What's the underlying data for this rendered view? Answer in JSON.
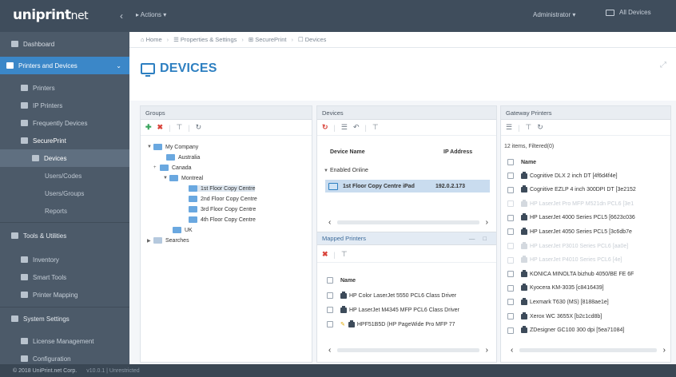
{
  "topbar": {
    "logo": "uniprint",
    "logo_suffix": "net",
    "collapse": "‹",
    "action": "▸ Actions ▾",
    "user": "Administrator ▾",
    "devices": "All Devices"
  },
  "sidebar": {
    "dashboard": "Dashboard",
    "printers_devices": "Printers and Devices",
    "printers": "Printers",
    "ip_printers": "IP Printers",
    "frequently_used": "Frequently Devices",
    "secureprint": "SecurePrint",
    "devices": "Devices",
    "users_codes": "Users/Codes",
    "users_groups": "Users/Groups",
    "reports": "Reports",
    "tools_utilities": "Tools & Utilities",
    "inventory": "Inventory",
    "smart_tools": "Smart Tools",
    "printer_mapping": "Printer Mapping",
    "system_settings": "System Settings",
    "license_management": "License Management",
    "configuration": "Configuration",
    "footer": "© 2018 UniPrint.net Corp.",
    "footer_extra": "v10.0.1 | Unrestricted"
  },
  "breadcrumb": {
    "home": "⌂ Home",
    "properties": "☰ Properties & Settings",
    "secureprint": "⊞ SecurePrint",
    "devices": "☐ Devices"
  },
  "page": {
    "title": "DEVICES",
    "expand": "⤢"
  },
  "groups": {
    "header": "Groups",
    "tb_add": "✚",
    "tb_del": "✖",
    "tb_filter": "⊤",
    "tb_refresh": "↻",
    "tree": {
      "my_company": "My Company",
      "australia": "Australia",
      "canada": "Canada",
      "montreal": "Montreal",
      "floor1": "1st Floor Copy Centre",
      "floor2": "2nd Floor Copy Centre",
      "floor3": "3rd Floor Copy Centre",
      "floor4": "4th Floor Copy Centre",
      "uk": "UK",
      "searches": "Searches"
    }
  },
  "devices": {
    "header": "Devices",
    "tb_refresh": "↻",
    "tb_list": "☰",
    "tb_back": "↶",
    "tb_filter": "⊤",
    "col_name": "Device Name",
    "col_ip": "IP Address",
    "group_label": "Enabled Online",
    "selected_device": "1st Floor Copy Centre iPad",
    "selected_ip": "192.0.2.173",
    "scroll_left": "‹",
    "scroll_right": "›"
  },
  "mapped": {
    "header": "Mapped Printers",
    "header_ctrls": "— □",
    "tb_del": "✖",
    "tb_filter": "⊤",
    "col_name": "Name",
    "rows": [
      "HP Color LaserJet 5550 PCL6 Class Driver",
      "HP LaserJet M4345 MFP PCL6 Class Driver",
      "HPF51B5D (HP PageWide Pro MFP 77"
    ],
    "scroll_left": "‹",
    "scroll_right": "›"
  },
  "gateway": {
    "header": "Gateway Printers",
    "tb_list": "☰",
    "tb_filter": "⊤",
    "tb_refresh": "↻",
    "status": "12 items, Filtered(0)",
    "col_name": "Name",
    "rows": [
      {
        "name": "Cognitive DLX 2 inch DT [4f6d4f4e]",
        "faded": false
      },
      {
        "name": "Cognitive EZLP 4 inch 300DPI DT [3e2152",
        "faded": false
      },
      {
        "name": "HP LaserJet Pro MFP M521dn PCL6 [3e1",
        "faded": true
      },
      {
        "name": "HP LaserJet 4000 Series PCL5 [6623c036",
        "faded": false
      },
      {
        "name": "HP LaserJet 4050 Series PCL5 [3c6db7e",
        "faded": false
      },
      {
        "name": "HP LaserJet P3010 Series PCL6 [aa0e]",
        "faded": true
      },
      {
        "name": "HP LaserJet P4010 Series PCL6 [4e]",
        "faded": true
      },
      {
        "name": "KONICA MINOLTA bizhub 4050/BE FE 6F",
        "faded": false
      },
      {
        "name": "Kyocera KM-3035 [c8416439]",
        "faded": false
      },
      {
        "name": "Lexmark T630 (MS) [8188ae1e]",
        "faded": false
      },
      {
        "name": "Xerox WC 3655X [b2c1cd8b]",
        "faded": false
      },
      {
        "name": "ZDesigner GC100 300 dpi [5ea71084]",
        "faded": false
      }
    ],
    "scroll_left": "‹",
    "scroll_right": "›"
  }
}
